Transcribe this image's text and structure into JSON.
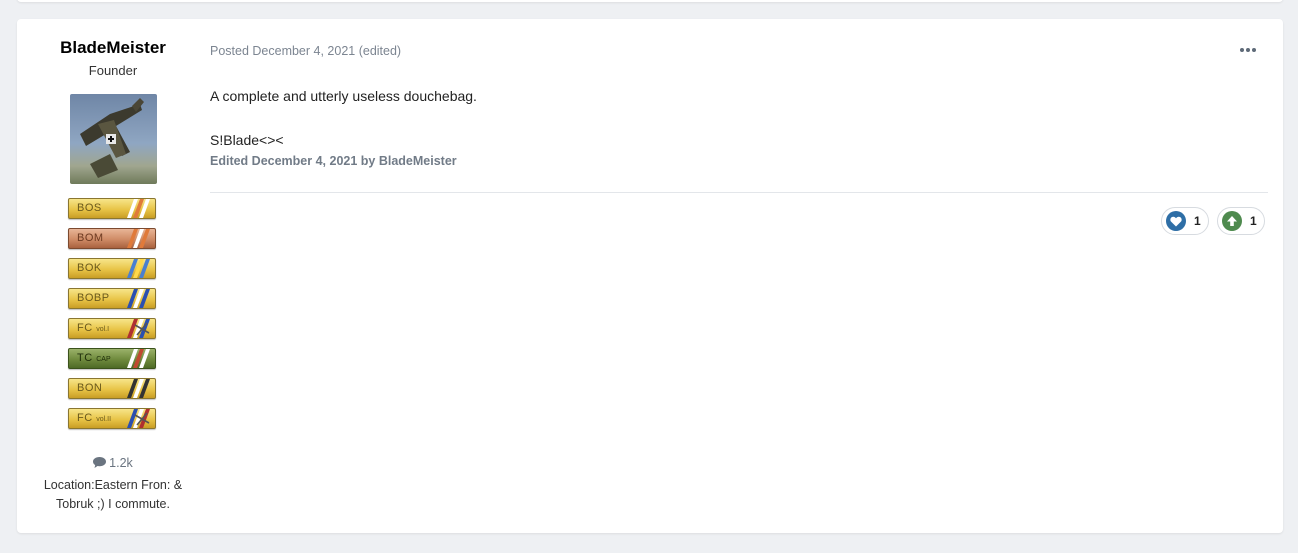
{
  "author": {
    "name": "BladeMeister",
    "title": "Founder",
    "badges": [
      {
        "label": "BOS",
        "sub": "",
        "style": "gold",
        "stripes": [
          "#ffffff",
          "#e07a3a",
          "#ffffff"
        ]
      },
      {
        "label": "BOM",
        "sub": "",
        "style": "bronze",
        "stripes": [
          "#e07a3a",
          "#ffffff",
          "#e07a3a"
        ]
      },
      {
        "label": "BOK",
        "sub": "",
        "style": "gold",
        "stripes": [
          "#4a7fd0",
          "#ffd84a",
          "#4a7fd0"
        ]
      },
      {
        "label": "BOBP",
        "sub": "",
        "style": "gold",
        "stripes": [
          "#2a4fb0",
          "#ffffff",
          "#2a4fb0"
        ]
      },
      {
        "label": "FC",
        "sub": "vol.I",
        "style": "gold",
        "stripes": [
          "#b03030",
          "#ffffff",
          "#2a4fb0"
        ]
      },
      {
        "label": "TC",
        "sub": "CAP",
        "style": "green",
        "stripes": [
          "#ffffff",
          "#c04a30",
          "#ffffff"
        ]
      },
      {
        "label": "BON",
        "sub": "",
        "style": "gold",
        "stripes": [
          "#333333",
          "#ffffff",
          "#333333"
        ]
      },
      {
        "label": "FC",
        "sub": "vol.II",
        "style": "gold",
        "stripes": [
          "#2a4fb0",
          "#ffffff",
          "#b03030"
        ]
      }
    ],
    "post_count": "1.2k",
    "location": "Location:Eastern Fron: & Tobruk ;) I commute."
  },
  "post": {
    "meta": "Posted December 4, 2021 (edited)",
    "paragraphs": [
      "A complete and utterly useless douchebag.",
      "S!Blade<><"
    ],
    "edited_note": "Edited December 4, 2021 by BladeMeister",
    "reactions": [
      {
        "name": "like",
        "icon": "heart-icon",
        "count": "1",
        "color": "#2e6ea6"
      },
      {
        "name": "upvote",
        "icon": "arrow-up-icon",
        "count": "1",
        "color": "#4e8a4e"
      }
    ]
  }
}
